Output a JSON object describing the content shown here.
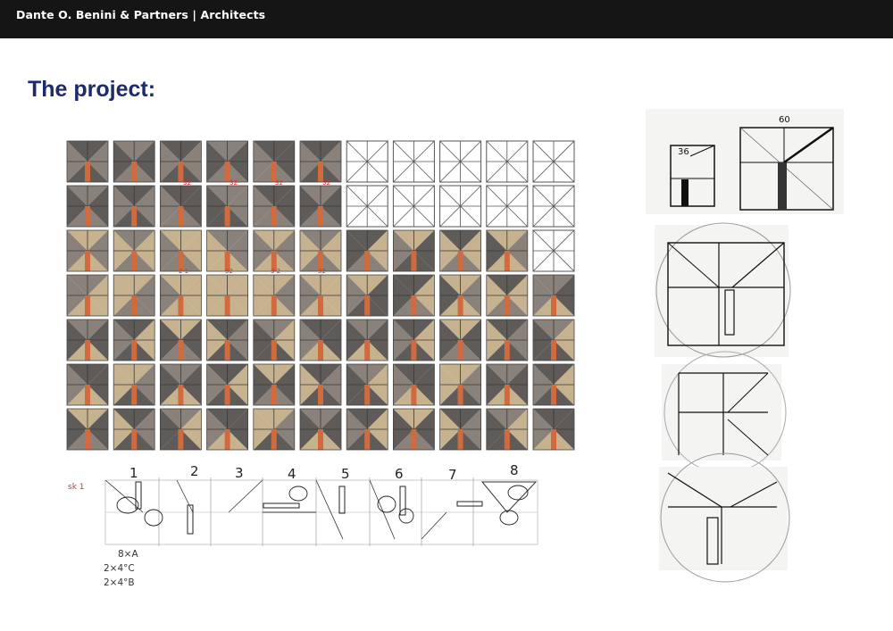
{
  "header": {
    "brand": "Dante O. Benini & Partners | Architects"
  },
  "page": {
    "title": "The project:"
  },
  "colors": {
    "bar": "#151515",
    "title": "#1d2a6b",
    "tile_dark": "#5f5b58",
    "tile_mid": "#8a817a",
    "tile_light": "#c7b28f",
    "tile_accent": "#d16a3d",
    "annotation_red": "#d2323a"
  },
  "tile_grid": {
    "rows": [
      [
        "fA",
        "fB",
        "fA",
        "fB",
        "fC",
        "fA",
        "blank",
        "blank",
        "blank",
        "blank",
        "blank"
      ],
      [
        "fB",
        "fA",
        "fC",
        "fD",
        "fC",
        "fB",
        "blank",
        "blank",
        "blank",
        "blank",
        "blank"
      ],
      [
        "fE",
        "fF",
        "fG",
        "fH",
        "fE",
        "fF",
        "fI",
        "fJ",
        "fK",
        "fL",
        "blank"
      ],
      [
        "fM",
        "fN",
        "fO",
        "fP",
        "fQ",
        "fO",
        "fJ",
        "fI",
        "fL",
        "fK",
        "fR"
      ],
      [
        "fS",
        "fT",
        "fU",
        "fV",
        "fW",
        "fX",
        "fS",
        "fT",
        "fU",
        "fV",
        "fW"
      ],
      [
        "fX",
        "fY",
        "fS",
        "fT",
        "fU",
        "fV",
        "fW",
        "fX",
        "fY",
        "fS",
        "fT"
      ],
      [
        "fU",
        "fV",
        "fW",
        "fX",
        "fY",
        "fS",
        "fT",
        "fU",
        "fV",
        "fW",
        "fX"
      ]
    ],
    "annotations_row2": [
      "32",
      "32",
      "32",
      "32"
    ],
    "annotations_row4": [
      "2 1",
      "32",
      "3 2",
      "32"
    ]
  },
  "study": {
    "label": "sk 1",
    "numbers": [
      "1",
      "2",
      "3",
      "4",
      "5",
      "6",
      "7",
      "8"
    ],
    "notes": [
      "8×A",
      "2×4°C",
      "2×4°B"
    ]
  },
  "side_sketches": {
    "top_dimensions": [
      "36",
      "60"
    ]
  }
}
